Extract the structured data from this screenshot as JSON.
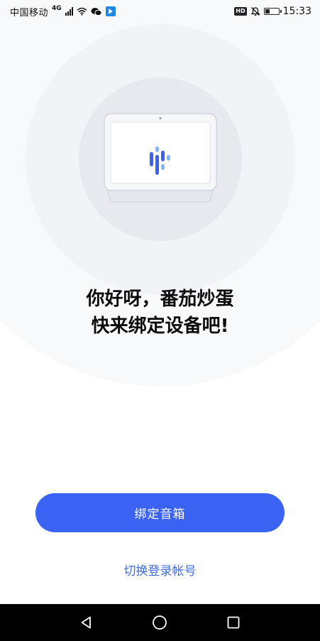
{
  "status_bar": {
    "carrier": "中国移动",
    "network_badge": "4G",
    "hd_label": "HD",
    "time": "15:33",
    "battery_level": 0.35
  },
  "greeting": {
    "line1": "你好呀，番茄炒蛋",
    "line2": "快来绑定设备吧!"
  },
  "actions": {
    "bind_speaker_label": "绑定音箱",
    "switch_account_label": "切换登录帐号"
  },
  "colors": {
    "primary": "#3a63f4",
    "link": "#3d6be0",
    "voice_blue": "#3a63f4",
    "voice_light": "#7fb6f5"
  },
  "icons": {
    "status_left": [
      "signal-icon",
      "wifi-icon",
      "wechat-icon",
      "app-notification-icon"
    ],
    "status_right": [
      "hd-icon",
      "mute-bell-icon",
      "battery-icon"
    ],
    "navigation": [
      "back-triangle-icon",
      "home-circle-icon",
      "recents-square-icon"
    ]
  }
}
